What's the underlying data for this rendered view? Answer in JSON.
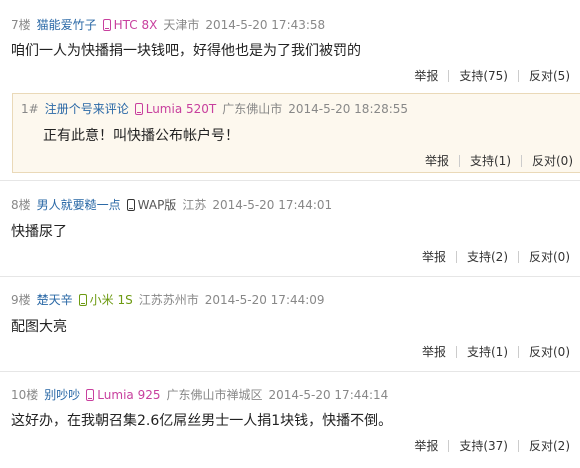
{
  "comments": [
    {
      "floor": "7楼",
      "user": "猫能爱竹子",
      "device": "HTC 8X",
      "location": "天津市",
      "time": "2014-5-20 17:43:58",
      "text": "咱们一人为快播捐一块钱吧，好得他也是为了我们被罚的",
      "actions": {
        "report": "举报",
        "support": "支持(75)",
        "oppose": "反对(5)"
      },
      "quote": {
        "floor": "1#",
        "user": "注册个号来评论",
        "device": "Lumia 520T",
        "location": "广东佛山市",
        "time": "2014-5-20 18:28:55",
        "text": "正有此意！叫快播公布帐户号！",
        "actions": {
          "report": "举报",
          "support": "支持(1)",
          "oppose": "反对(0)"
        }
      }
    },
    {
      "floor": "8楼",
      "user": "男人就要糙一点",
      "device": "WAP版",
      "location": "江苏",
      "time": "2014-5-20 17:44:01",
      "text": "快播尿了",
      "actions": {
        "report": "举报",
        "support": "支持(2)",
        "oppose": "反对(0)"
      }
    },
    {
      "floor": "9楼",
      "user": "楚天辛",
      "device": "小米 1S",
      "location": "江苏苏州市",
      "time": "2014-5-20 17:44:09",
      "text": "配图大亮",
      "actions": {
        "report": "举报",
        "support": "支持(1)",
        "oppose": "反对(0)"
      }
    },
    {
      "floor": "10楼",
      "user": "别吵吵",
      "device": "Lumia 925",
      "location": "广东佛山市禅城区",
      "time": "2014-5-20 17:44:14",
      "text": "这好办，在我朝召集2.6亿屌丝男士一人捐1块钱，快播不倒。",
      "actions": {
        "report": "举报",
        "support": "支持(37)",
        "oppose": "反对(2)"
      }
    }
  ],
  "colors": {
    "username": "#2a68a6",
    "device_pink": "#c8409e",
    "device_green": "#6d9a12",
    "quote_bg": "#fdf8ee"
  }
}
